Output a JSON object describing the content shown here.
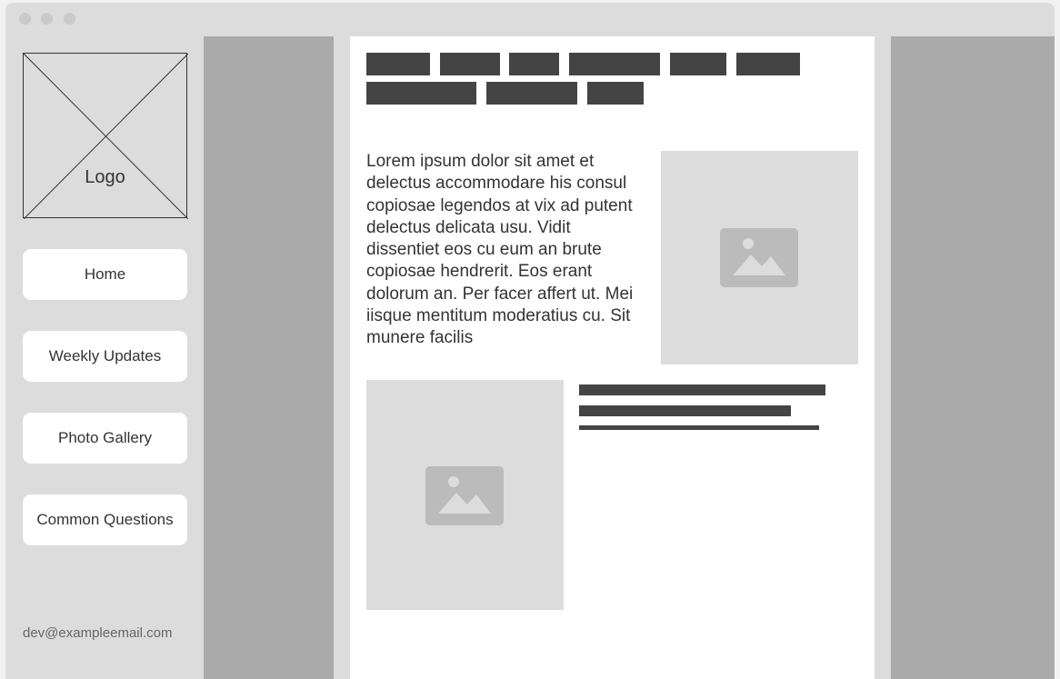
{
  "window": {
    "controls": [
      "close",
      "minimize",
      "maximize"
    ]
  },
  "sidebar": {
    "logo_label": "Logo",
    "nav": [
      {
        "label": "Home"
      },
      {
        "label": "Weekly Updates"
      },
      {
        "label": "Photo Gallery"
      },
      {
        "label": "Common Questions"
      }
    ],
    "email": "dev@exampleemail.com"
  },
  "main": {
    "tag_count": 9,
    "body_text": "Lorem ipsum dolor sit amet et delectus accommodare his consul copiosae legendos at vix ad putent delectus delicata usu. Vidit dissentiet eos cu eum an brute copiosae hendrerit. Eos erant dolorum an. Per facer affert ut. Mei iisque mentitum moderatius cu. Sit munere facilis",
    "images": [
      {
        "icon": "image-icon"
      },
      {
        "icon": "image-icon"
      }
    ]
  },
  "colors": {
    "chrome": "#dcdcdc",
    "column": "#aaaaaa",
    "placeholder_block": "#444444",
    "card": "#ffffff"
  }
}
